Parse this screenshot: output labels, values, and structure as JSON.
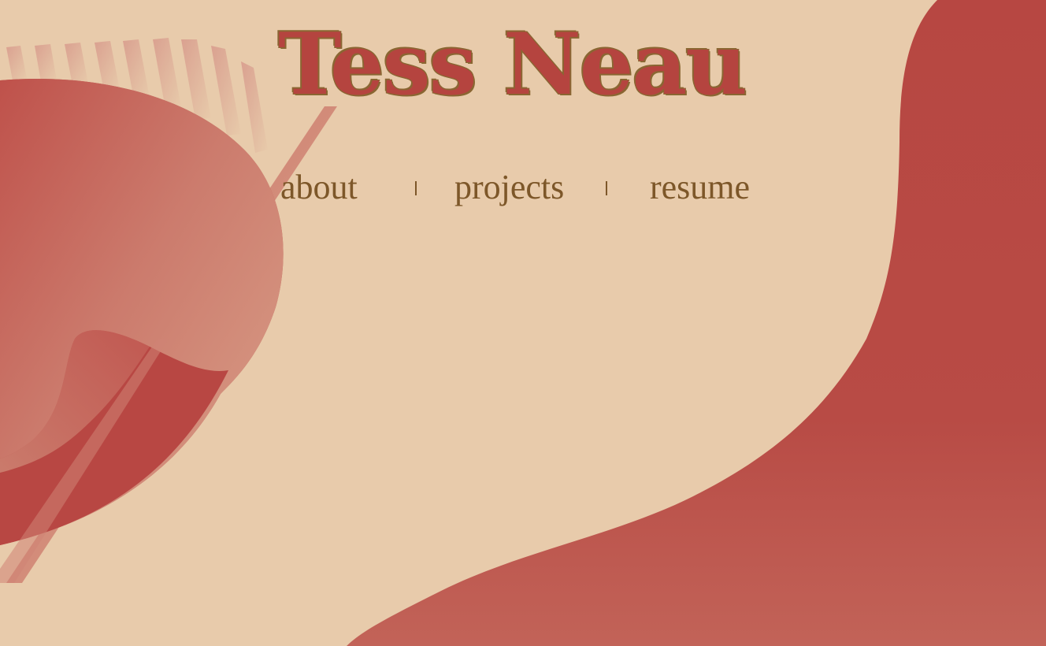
{
  "header": {
    "title": "Tess Neau"
  },
  "nav": {
    "items": [
      {
        "label": "about"
      },
      {
        "label": "projects"
      },
      {
        "label": "resume"
      }
    ]
  },
  "colors": {
    "background": "#e8cbab",
    "accent_red": "#b5443f",
    "title_shadow": "#8a6632",
    "nav_text": "#7d5729"
  }
}
